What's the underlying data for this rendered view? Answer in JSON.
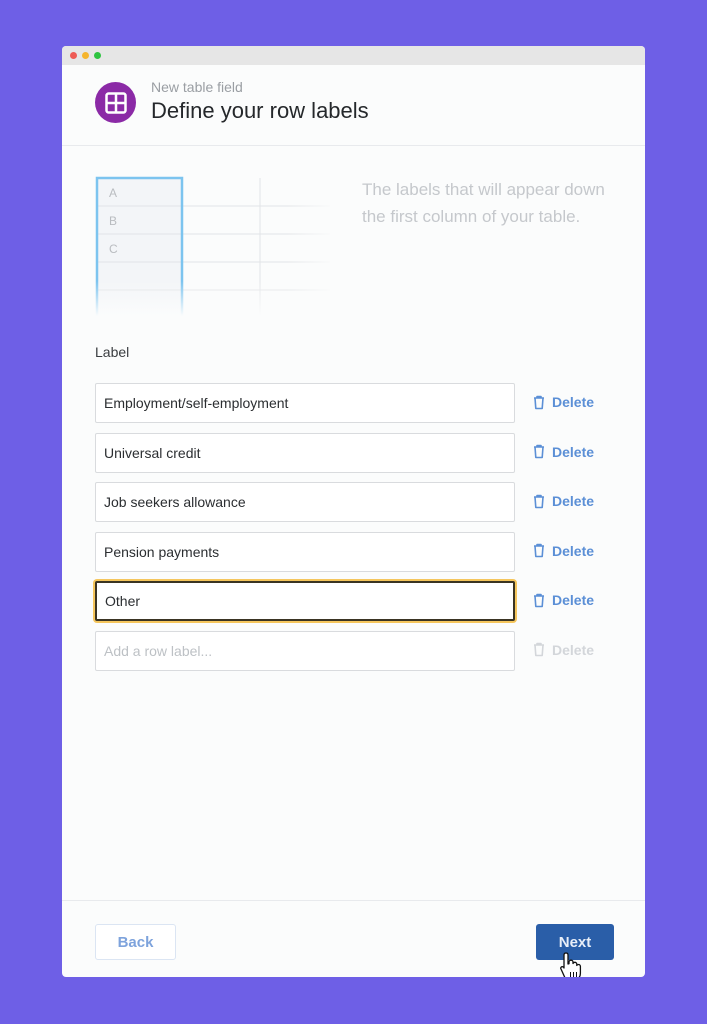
{
  "window": {
    "controls": [
      "close",
      "minimize",
      "maximize"
    ]
  },
  "header": {
    "icon": "table-grid-icon",
    "subtitle": "New table field",
    "title": "Define your row labels"
  },
  "preview": {
    "row_letters": [
      "A",
      "B",
      "C"
    ]
  },
  "description": "The labels that will appear down the first column of your table.",
  "form": {
    "label": "Label",
    "rows": [
      {
        "value": "Employment/self-employment",
        "delete_label": "Delete"
      },
      {
        "value": "Universal credit",
        "delete_label": "Delete"
      },
      {
        "value": "Job seekers allowance",
        "delete_label": "Delete"
      },
      {
        "value": "Pension payments",
        "delete_label": "Delete"
      },
      {
        "value": "Other",
        "delete_label": "Delete",
        "focused": true
      }
    ],
    "new_row": {
      "placeholder": "Add a row label...",
      "delete_label": "Delete"
    }
  },
  "footer": {
    "back_label": "Back",
    "next_label": "Next"
  },
  "colors": {
    "background": "#6e5fe6",
    "accent_purple": "#8b2aa6",
    "primary_button": "#2a5ea8",
    "link_blue": "#5b8fd6",
    "focus_ring": "#f5c65d"
  }
}
